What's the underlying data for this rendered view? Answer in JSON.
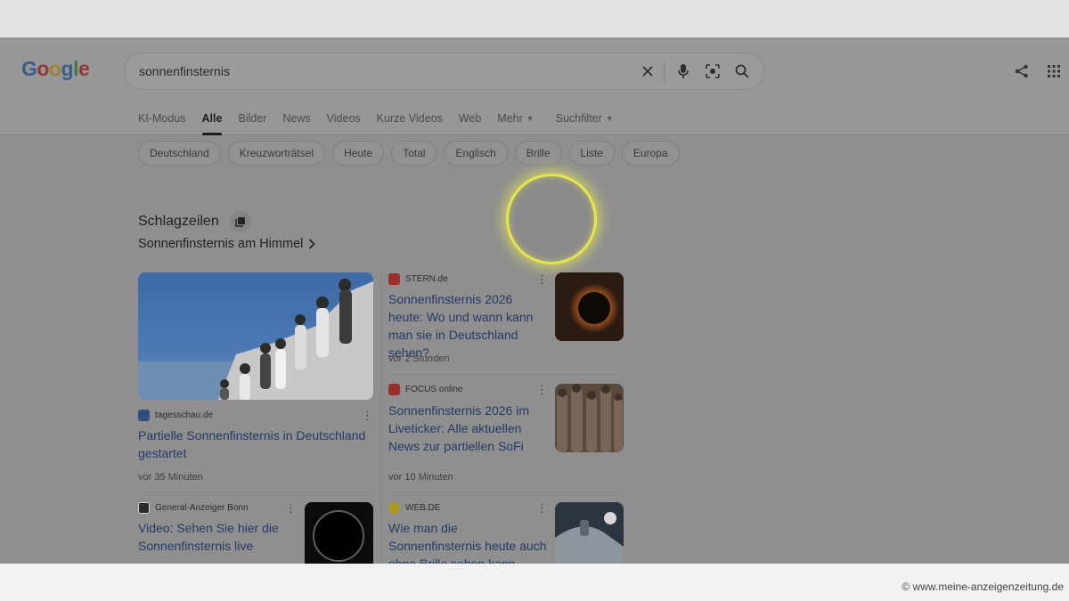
{
  "header": {
    "logo": [
      "G",
      "o",
      "o",
      "g",
      "l",
      "e"
    ],
    "search_value": "sonnenfinsternis"
  },
  "nav": {
    "items": [
      "KI-Modus",
      "Alle",
      "Bilder",
      "News",
      "Videos",
      "Kurze Videos",
      "Web",
      "Mehr",
      "Suchfilter"
    ],
    "active": "Alle"
  },
  "chips": [
    "Deutschland",
    "Kreuzworträtsel",
    "Heute",
    "Total",
    "Englisch",
    "Brille",
    "Liste",
    "Europa"
  ],
  "news": {
    "title": "Schlagzeilen",
    "subtitle": "Sonnenfinsternis am Himmel",
    "cards": [
      {
        "source": "tagesschau.de",
        "headline": "Partielle Sonnenfinsternis in Deutschland gestartet",
        "time": "vor 35 Minuten"
      },
      {
        "source": "STERN.de",
        "headline": "Sonnenfinsternis 2026 heute: Wo und wann kann man sie in Deutschland sehen?",
        "time": "vor 2 Stunden"
      },
      {
        "source": "FOCUS online",
        "headline": "Sonnenfinsternis 2026 im Liveticker: Alle aktuellen News zur partiellen SoFi",
        "time": "vor 10 Minuten"
      },
      {
        "source": "General-Anzeiger Bonn",
        "headline": "Video: Sehen Sie hier die Sonnenfinsternis live",
        "time": ""
      },
      {
        "source": "WEB.DE",
        "headline": "Wie man die Sonnenfinsternis heute auch ohne Brille sehen kann",
        "time": ""
      }
    ]
  },
  "watermark": "© www.meine-anzeigenzeitung.de",
  "colors": {
    "link": "#243a66",
    "eclipse_ring": "#e6e54a",
    "overlay_bg": "#8f8f8f"
  }
}
